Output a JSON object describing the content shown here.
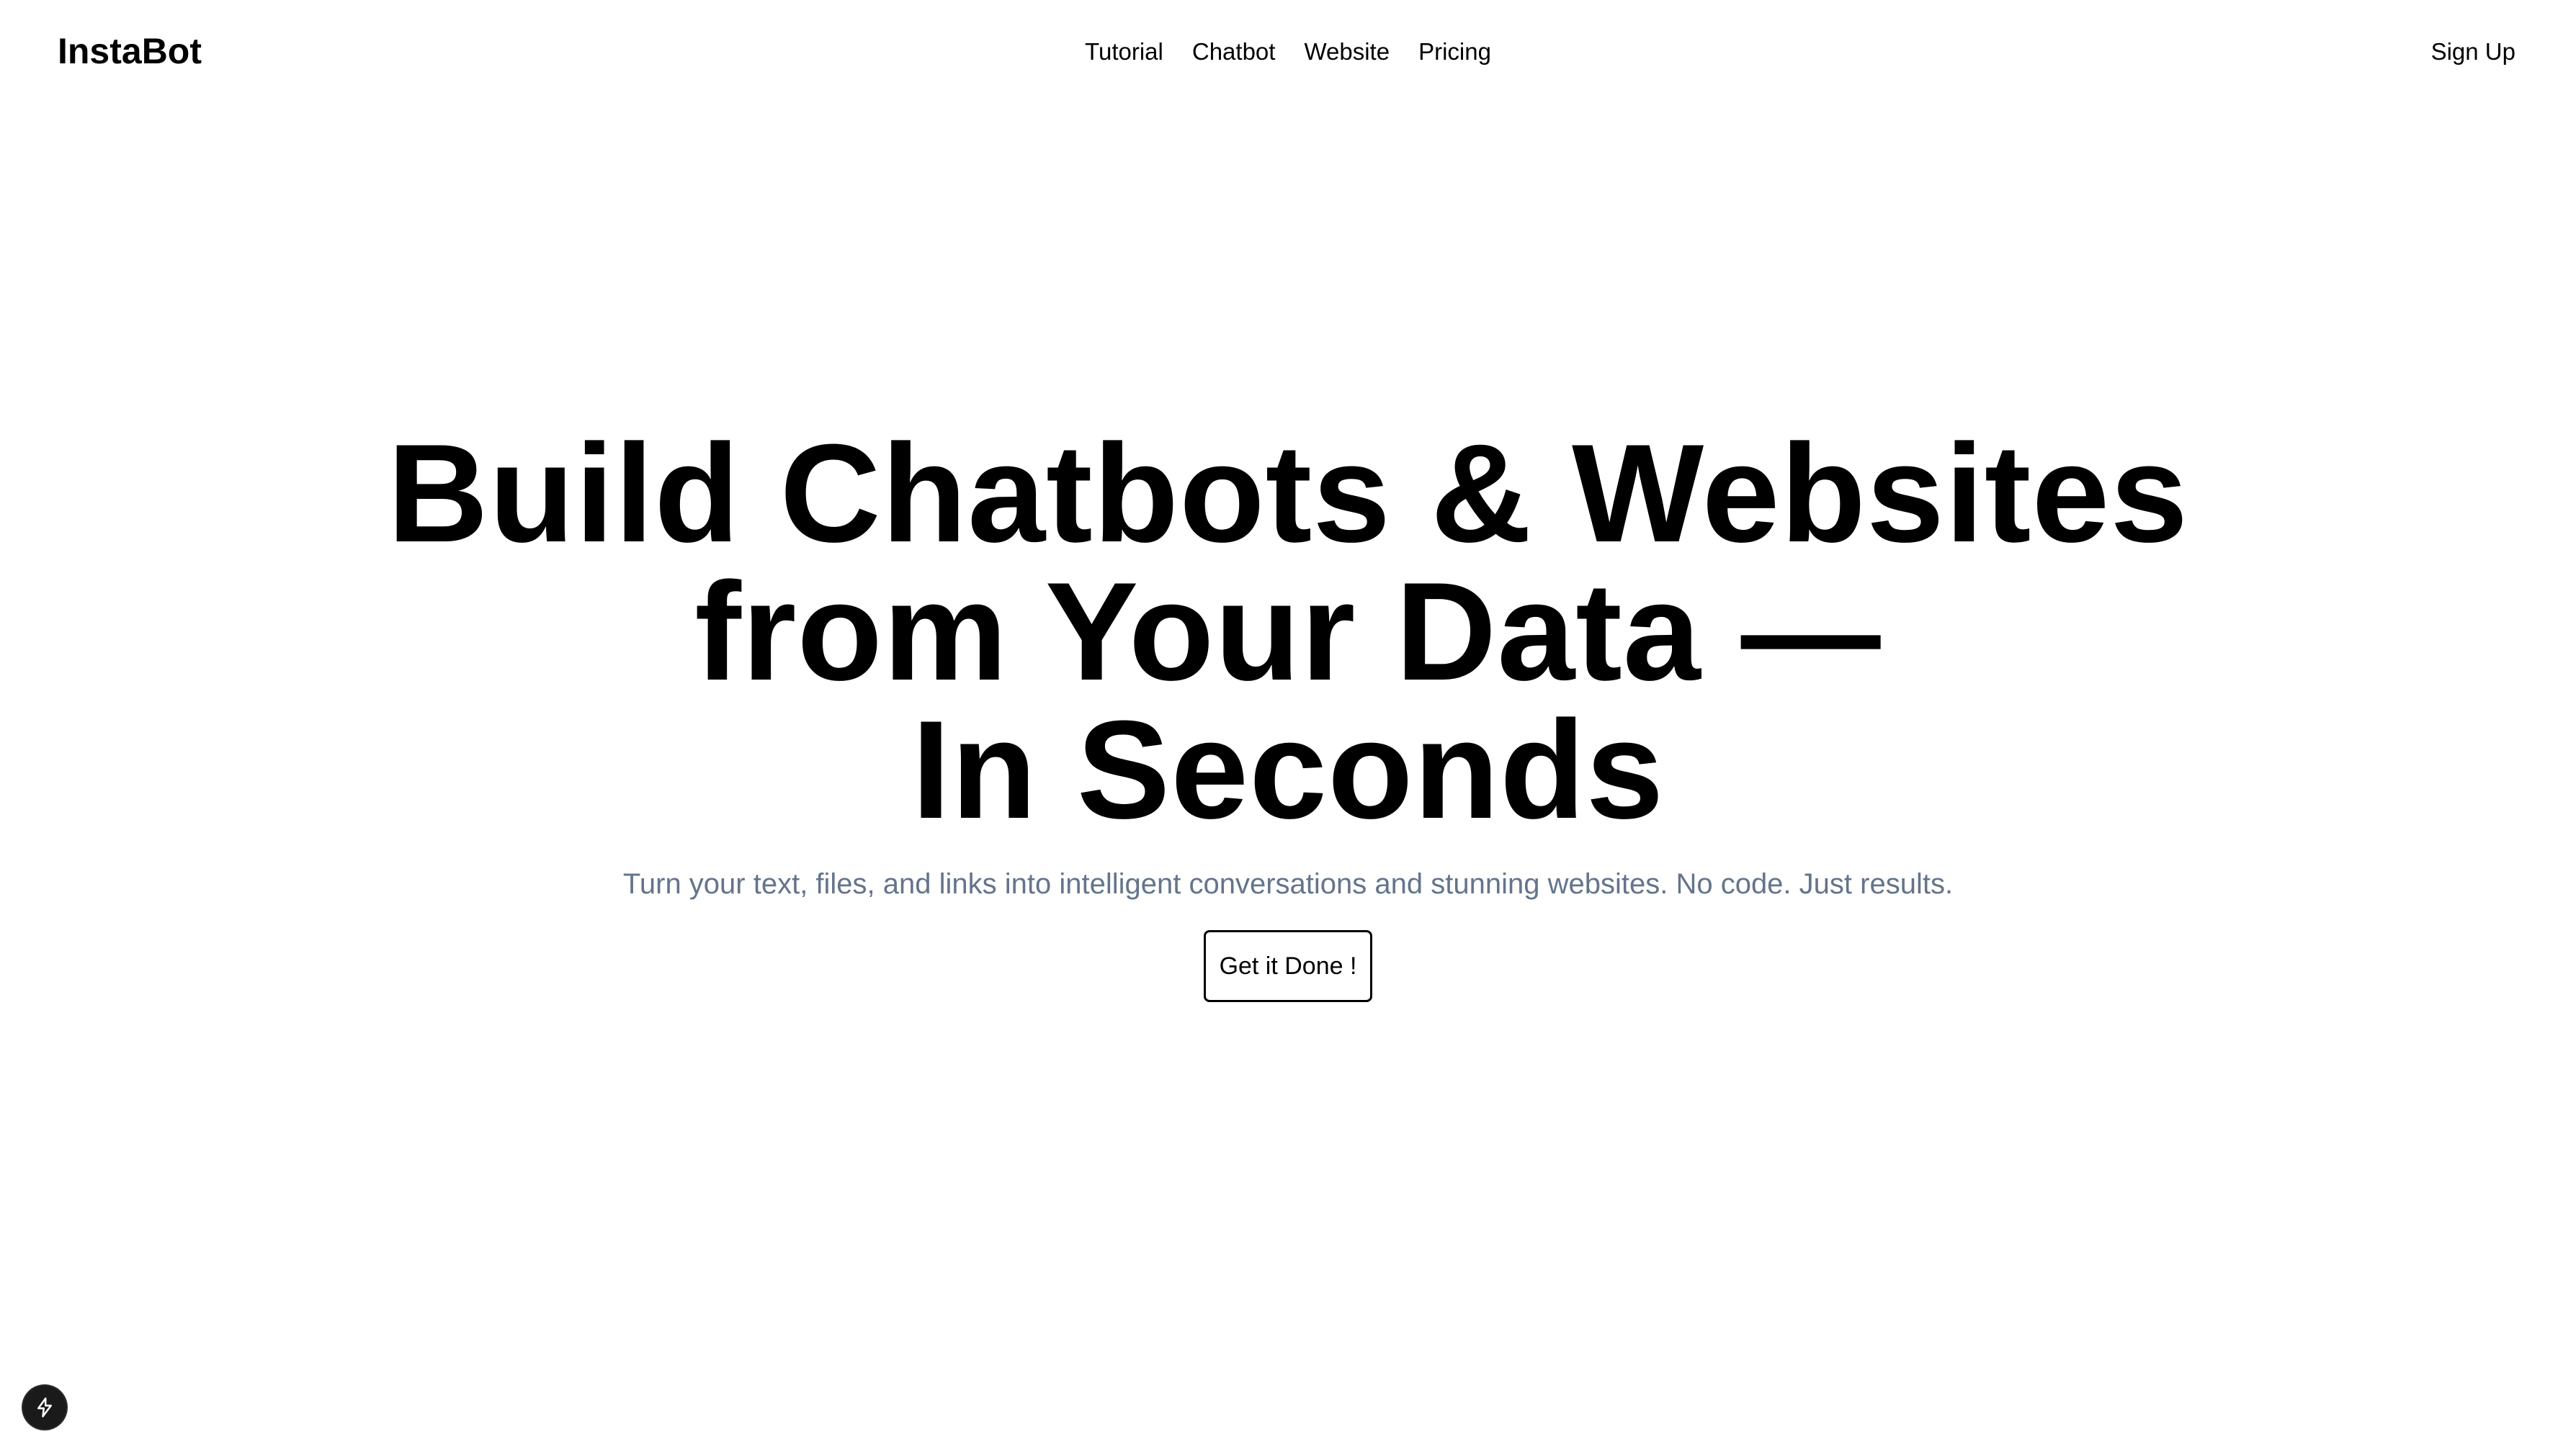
{
  "header": {
    "logo": "InstaBot",
    "nav": [
      {
        "label": "Tutorial"
      },
      {
        "label": "Chatbot"
      },
      {
        "label": "Website"
      },
      {
        "label": "Pricing"
      }
    ],
    "signup_label": "Sign Up"
  },
  "hero": {
    "title_lines": [
      "Build Chatbots & Websites",
      "from Your Data —",
      "In Seconds"
    ],
    "subtitle": "Turn your text, files, and links into intelligent conversations and stunning websites. No code. Just results.",
    "cta_label": "Get it Done !"
  },
  "dev_badge": {
    "icon": "lightning-bolt-icon"
  },
  "colors": {
    "background": "#ffffff",
    "text": "#000000",
    "subtitle": "#64748b",
    "badge": "#1a1a1a"
  }
}
